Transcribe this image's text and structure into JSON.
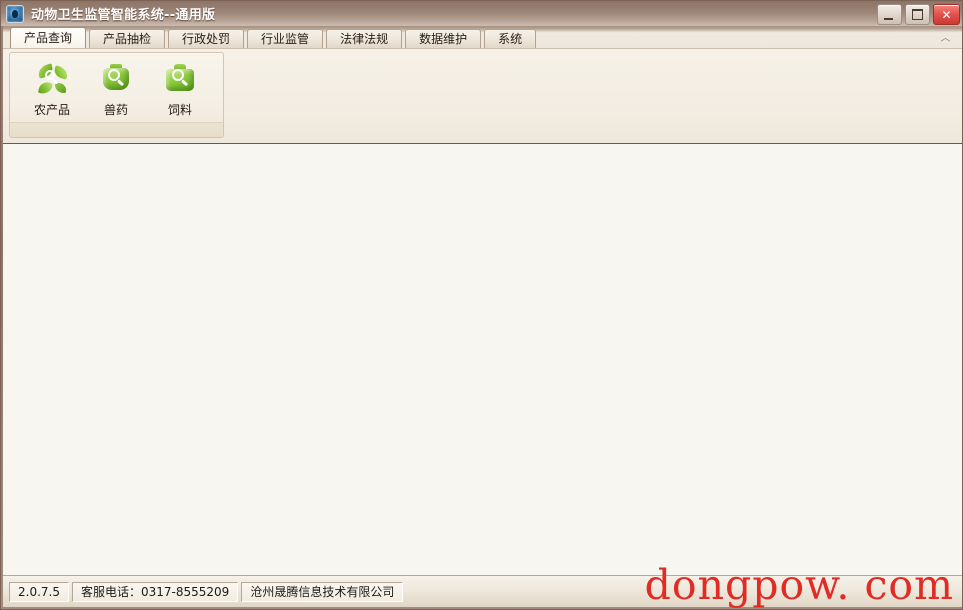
{
  "window": {
    "title": "动物卫生监管智能系统--通用版",
    "app_icon": "app-shield-icon",
    "controls": {
      "minimize": "minimize-button",
      "maximize": "maximize-button",
      "close_label": "✕"
    }
  },
  "ribbon": {
    "tabs": [
      {
        "label": "产品查询",
        "active": true
      },
      {
        "label": "产品抽检",
        "active": false
      },
      {
        "label": "行政处罚",
        "active": false
      },
      {
        "label": "行业监管",
        "active": false
      },
      {
        "label": "法律法规",
        "active": false
      },
      {
        "label": "数据维护",
        "active": false
      },
      {
        "label": "系统",
        "active": false
      }
    ],
    "collapse_icon": "︿",
    "groups": [
      {
        "buttons": [
          {
            "label": "农产品",
            "icon": "leaf-search-icon"
          },
          {
            "label": "兽药",
            "icon": "bottle-search-icon"
          },
          {
            "label": "饲料",
            "icon": "feedbag-search-icon"
          }
        ]
      }
    ]
  },
  "statusbar": {
    "version": "2.0.7.5",
    "support_phone": "客服电话：0317-8555209",
    "company": "沧州晟腾信息技术有限公司"
  },
  "watermark": {
    "text": "dongpow. com",
    "color": "#e12c26"
  },
  "colors": {
    "titlebar": "#8d7468",
    "ribbon_bg": "#f1ece3",
    "content_bg": "#f8f6f1",
    "accent_green": "#7ab92f",
    "close_red": "#e2524c"
  }
}
